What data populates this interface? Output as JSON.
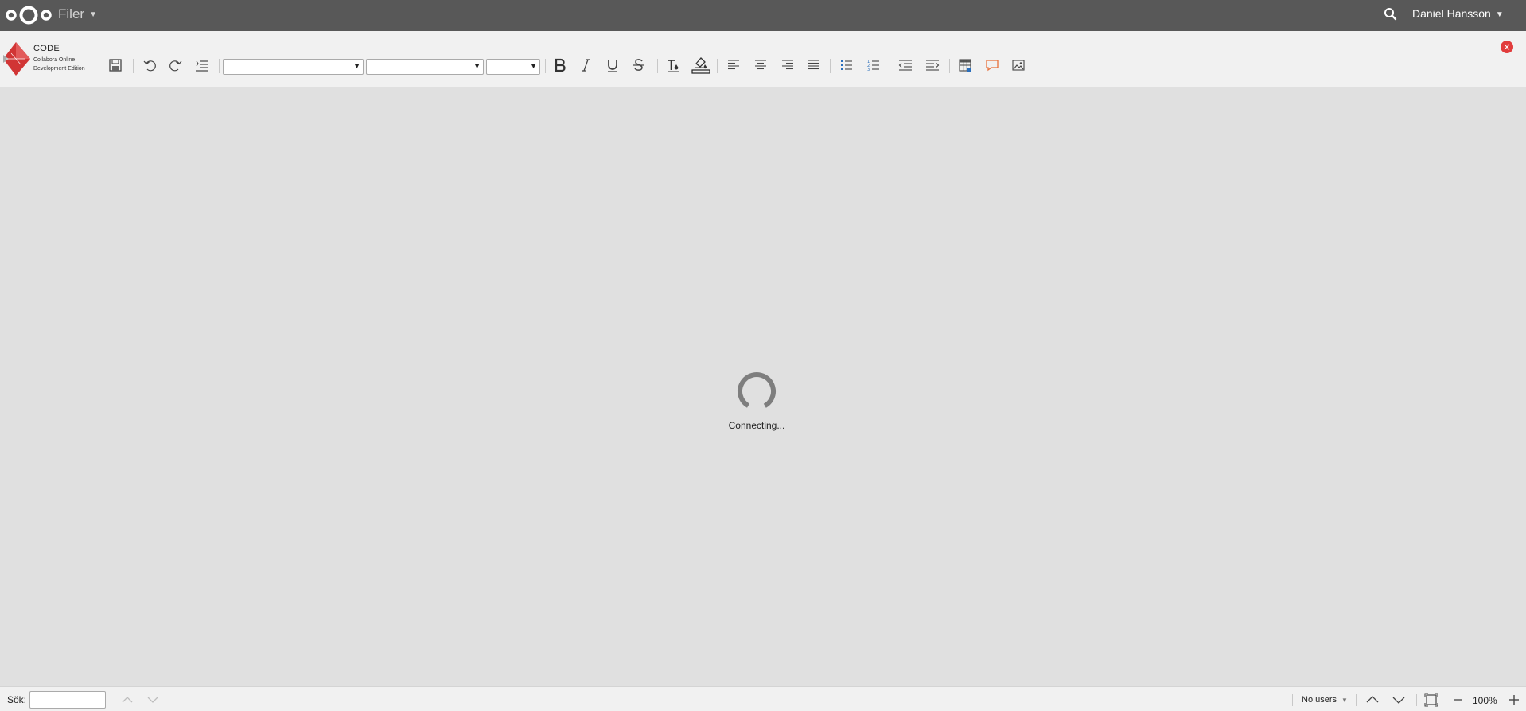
{
  "header": {
    "app_name": "Filer",
    "user_name": "Daniel Hansson"
  },
  "brand": {
    "title": "CODE",
    "subtitle_line1": "Collabora Online",
    "subtitle_line2": "Development Edition"
  },
  "toolbar": {
    "font_style_value": "",
    "font_name_value": "",
    "font_size_value": "",
    "buttons": [
      "save",
      "undo",
      "redo",
      "format-lines",
      "bold",
      "italic",
      "underline",
      "strikethrough",
      "text-color",
      "highlight-color",
      "align-left",
      "align-center",
      "align-right",
      "justify",
      "bullet-list",
      "numbered-list",
      "decrease-indent",
      "increase-indent",
      "insert-table",
      "insert-comment",
      "insert-image"
    ]
  },
  "document": {
    "status": "Connecting..."
  },
  "statusbar": {
    "search_label": "Sök:",
    "search_value": "",
    "users_label": "No users",
    "zoom": "100%"
  },
  "colors": {
    "header_bg": "#585858",
    "toolbar_bg": "#f1f1f1",
    "doc_bg": "#e0e0e0",
    "close_red": "#e13c3c",
    "comment_orange": "#e8703a",
    "brand_red": "#d13535"
  }
}
